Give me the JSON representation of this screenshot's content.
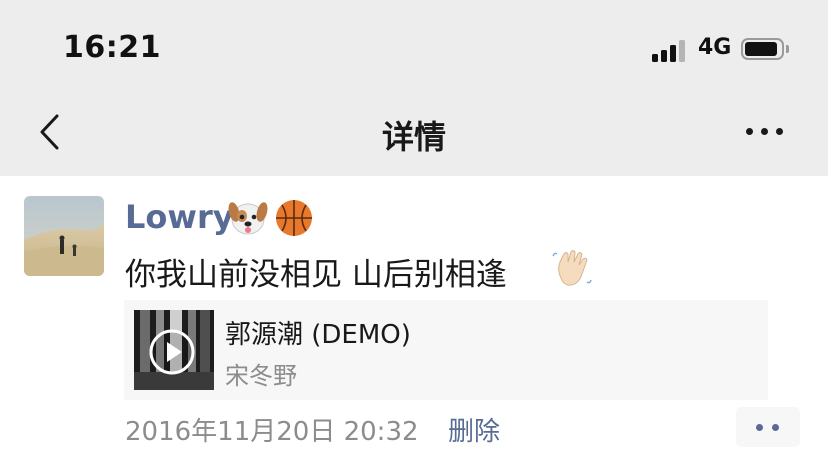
{
  "status_bar": {
    "time": "16:21",
    "network": "4G"
  },
  "nav": {
    "title": "详情"
  },
  "post": {
    "author": "Lowry",
    "author_emojis": [
      "dog-face-icon",
      "basketball-icon"
    ],
    "text": "你我山前没相见 山后别相逢",
    "text_emoji": "waving-hand-icon",
    "music": {
      "title": "郭源潮 (DEMO)",
      "artist": "宋冬野"
    },
    "timestamp": "2016年11月20日 20:32",
    "delete_label": "删除"
  },
  "colors": {
    "topbar_bg": "#ededed",
    "link_blue": "#576b95",
    "secondary_text": "#8c8c8c",
    "card_bg": "#f7f7f7"
  }
}
